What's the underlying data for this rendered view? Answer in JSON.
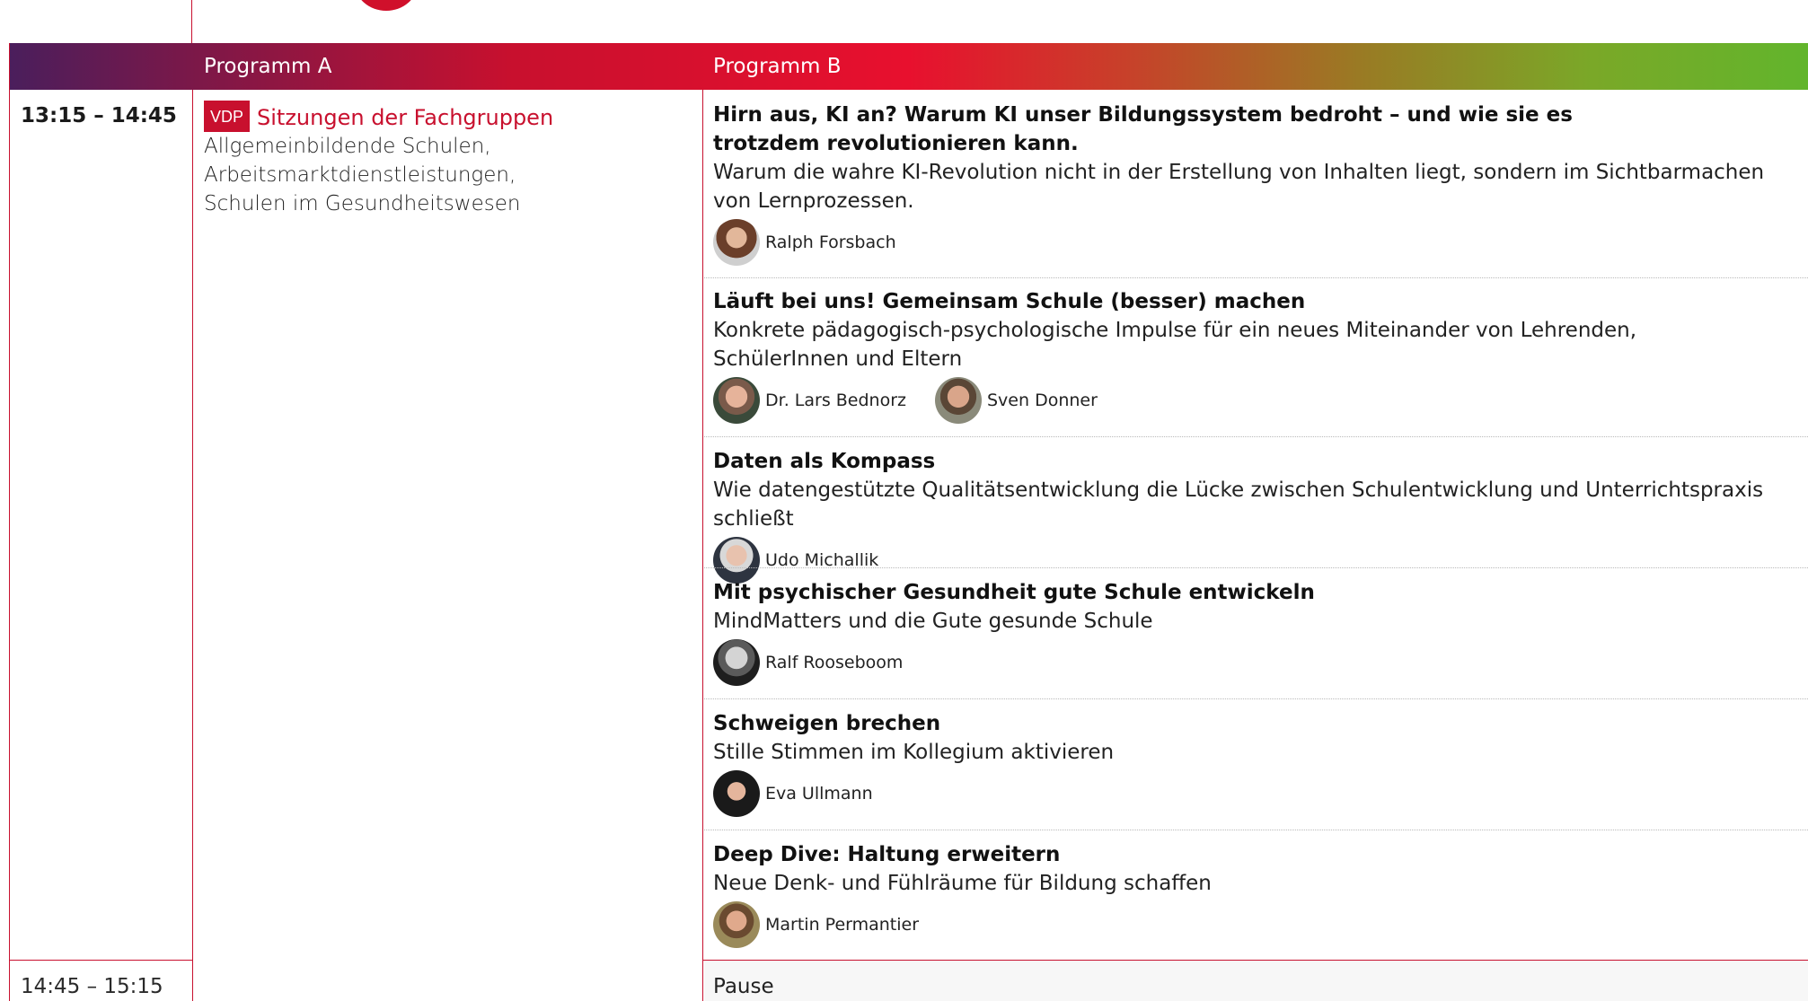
{
  "header": {
    "programm_a": "Programm A",
    "programm_b": "Programm B"
  },
  "colors": {
    "accent_red": "#c8102e",
    "gradient_start": "#4a1e5c",
    "gradient_end": "#62b52c"
  },
  "rows": {
    "main": {
      "time": "13:15  – 14:45",
      "programm_a": {
        "badge": "VDP",
        "title": "Sitzungen der Fachgruppen",
        "lines": [
          "Allgemeinbildende Schulen,",
          "Arbeitsmarktdienstleistungen,",
          "Schulen im Gesundheitswesen"
        ]
      }
    },
    "pause": {
      "time": "14:45  – 15:15",
      "label": "Pause"
    }
  },
  "sessions": [
    {
      "title": "Hirn aus, KI an? Warum KI unser Bildungssystem bedroht – und wie sie es trotzdem revolutionieren kann.",
      "description": "Warum die wahre KI-Revolution nicht in der Erstellung von Inhalten liegt, sondern im Sichtbarmachen von Lernprozessen.",
      "speakers": [
        "Ralph Forsbach"
      ]
    },
    {
      "title": "Läuft bei uns! Gemeinsam Schule (besser) machen",
      "description": "Konkrete pädagogisch-psychologische Impulse für ein neues Miteinander von Lehrenden, SchülerInnen und Eltern",
      "speakers": [
        "Dr. Lars Bednorz",
        "Sven Donner"
      ]
    },
    {
      "title": "Daten als Kompass",
      "description": "Wie datengestützte Qualitätsentwicklung die Lücke zwischen Schulentwicklung und Unterrichtspraxis schließt",
      "speakers": [
        "Udo Michallik"
      ]
    },
    {
      "title": "Mit psychischer Gesundheit gute Schule entwickeln",
      "description": "MindMatters und die Gute gesunde Schule",
      "speakers": [
        "Ralf Rooseboom"
      ]
    },
    {
      "title": "Schweigen brechen",
      "description": "Stille Stimmen im Kollegium aktivieren",
      "speakers": [
        "Eva Ullmann"
      ]
    },
    {
      "title": "Deep Dive: Haltung erweitern",
      "description": "Neue Denk- und Fühlräume für Bildung schaffen",
      "speakers": [
        "Martin Permantier"
      ]
    }
  ]
}
